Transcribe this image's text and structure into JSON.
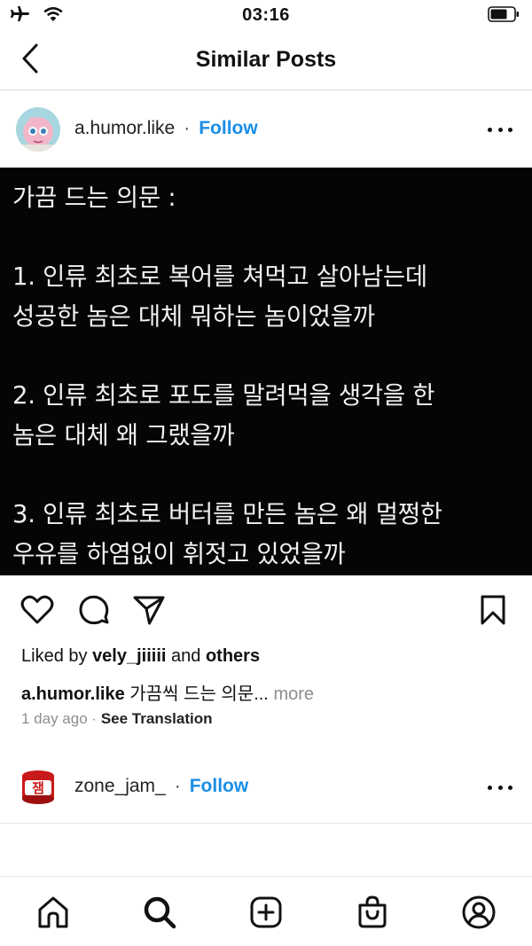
{
  "status_bar": {
    "time": "03:16"
  },
  "nav": {
    "title": "Similar Posts"
  },
  "post": {
    "username": "a.humor.like",
    "separator": "·",
    "follow_label": "Follow",
    "image_lines": [
      "가끔 드는 의문 :",
      "1. 인류 최초로 복어를 쳐먹고 살아남는데",
      "성공한 놈은 대체 뭐하는 놈이었을까",
      "2. 인류 최초로 포도를 말려먹을 생각을 한",
      "놈은 대체 왜 그랬을까",
      "3. 인류 최초로 버터를 만든 놈은 왜 멀쩡한",
      "우유를 하염없이 휘젓고 있었을까"
    ],
    "likes_prefix": "Liked by",
    "liked_by_user": "vely_jiiiii",
    "likes_and": "and",
    "likes_others": "others",
    "caption_text": "가끔씩 드는 의문...",
    "caption_more": "more",
    "time_ago": "1 day ago",
    "see_translation": "See Translation"
  },
  "next_post": {
    "username": "zone_jam_",
    "separator": "·",
    "follow_label": "Follow",
    "avatar_text": "잼"
  },
  "colors": {
    "accent": "#1a8fe6",
    "image_bg": "#050505",
    "muted": "#8e8e8e"
  },
  "icons": {
    "status_left": [
      "airplane-icon",
      "wifi-icon"
    ],
    "status_right": [
      "battery-icon"
    ],
    "actions": [
      "heart-icon",
      "comment-icon",
      "share-icon",
      "bookmark-icon"
    ],
    "tabs": [
      "home-icon",
      "search-icon",
      "add-post-icon",
      "shop-icon",
      "profile-icon"
    ]
  }
}
